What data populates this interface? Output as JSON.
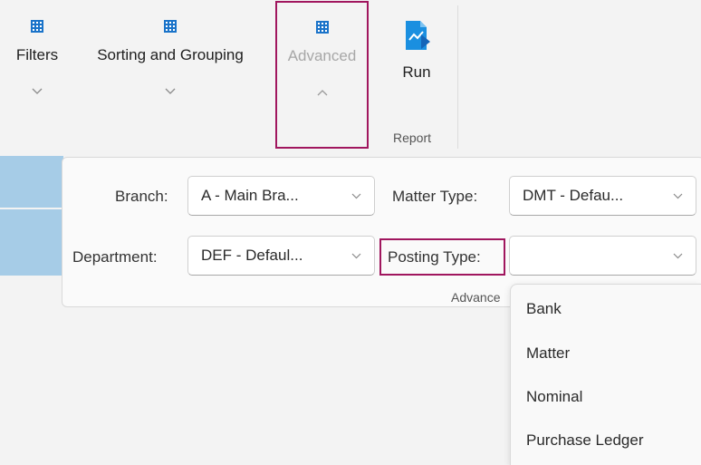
{
  "ribbon": {
    "filters_label": "Filters",
    "sorting_label": "Sorting and Grouping",
    "advanced_label": "Advanced",
    "run_label": "Run",
    "report_group_label": "Report"
  },
  "advanced_panel": {
    "branch_label": "Branch:",
    "branch_value": "A - Main Bra...",
    "matter_type_label": "Matter Type:",
    "matter_type_value": "DMT - Defau...",
    "department_label": "Department:",
    "department_value": "DEF - Defaul...",
    "posting_type_label": "Posting Type:",
    "posting_type_value": "",
    "group_footer_label": "Advance"
  },
  "posting_type_options": [
    "Bank",
    "Matter",
    "Nominal",
    "Purchase Ledger"
  ],
  "colors": {
    "accent_highlight": "#a0165e",
    "selection_blue": "#a6cce7",
    "icon_blue": "#1a73c9"
  },
  "icons": {
    "filters": "grid-icon",
    "sorting": "grid-icon",
    "advanced": "grid-icon",
    "run": "report-chart-icon"
  }
}
